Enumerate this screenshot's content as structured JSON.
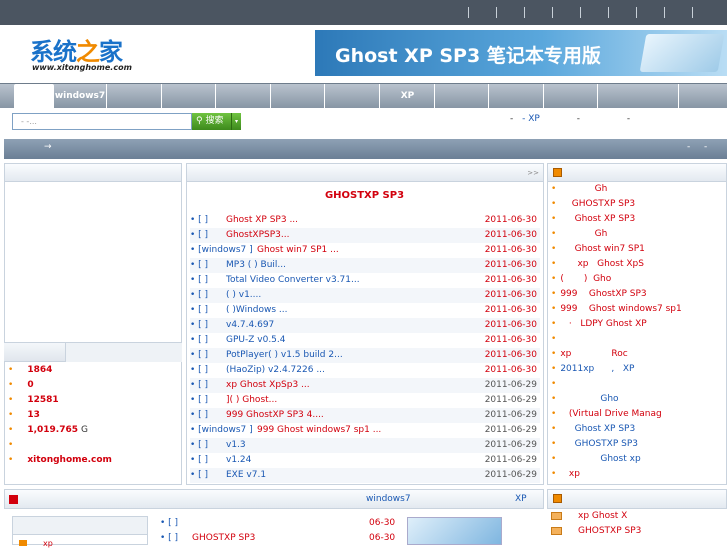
{
  "topbar": {
    "separators": 9
  },
  "logo": {
    "brand_main": "系统",
    "brand_accent": "之",
    "brand_tail": "家",
    "url": "www.xitonghome.com"
  },
  "banner": {
    "text": "Ghost XP SP3 笔记本专用版"
  },
  "nav": {
    "items": [
      "",
      "windows7",
      "",
      "",
      "",
      "",
      "",
      "XP",
      "",
      "",
      "",
      ""
    ]
  },
  "search": {
    "placeholder": "- -...",
    "button_label": "搜索",
    "dropdown": "▾"
  },
  "hotlinks": [
    "-",
    "- XP",
    "-",
    "-"
  ],
  "bluebar": {
    "arrow": "→",
    "dashes": [
      "-",
      "-"
    ]
  },
  "stats": [
    {
      "value": "1864"
    },
    {
      "value": "0"
    },
    {
      "value": "12581"
    },
    {
      "value": "13"
    },
    {
      "value": "1,019.765",
      "unit": "G"
    },
    {
      "value": ""
    },
    {
      "value": "xitonghome.com"
    }
  ],
  "center": {
    "more": ">>",
    "title": "GHOSTXP SP3",
    "rows": [
      {
        "cat": "• [  ]",
        "title": "Ghost XP SP3     ...",
        "date": "2011-06-30",
        "blue": false
      },
      {
        "cat": "• [  ]",
        "title": "          GhostXPSP3...",
        "date": "2011-06-30",
        "blue": false
      },
      {
        "cat": "• [windows7  ]",
        "title": "Ghost win7 SP1      ...",
        "date": "2011-06-30",
        "blue": false
      },
      {
        "cat": "• [  ]",
        "title": "MP3    (      ) Buil...",
        "date": "2011-06-30",
        "blue": true
      },
      {
        "cat": "• [  ]",
        "title": "  Total Video Converter v3.71...",
        "date": "2011-06-30",
        "blue": true
      },
      {
        "cat": "• [  ]",
        "title": "(       )      v1....",
        "date": "2011-06-30",
        "blue": true
      },
      {
        "cat": "• [  ]",
        "title": "(       )Windows    ...",
        "date": "2011-06-30",
        "blue": true
      },
      {
        "cat": "• [  ]",
        "title": "      v4.7.4.697",
        "date": "2011-06-30",
        "blue": true
      },
      {
        "cat": "• [  ]",
        "title": "GPU-Z v0.5.4",
        "date": "2011-06-30",
        "blue": true
      },
      {
        "cat": "• [  ]",
        "title": "PotPlayer(     ) v1.5 build 2...",
        "date": "2011-06-30",
        "blue": true
      },
      {
        "cat": "• [  ]",
        "title": "     (HaoZip) v2.4.7226    ...",
        "date": "2011-06-30",
        "blue": true
      },
      {
        "cat": "• [  ]",
        "title": "     xp   Ghost XpSp3    ...",
        "date": "2011-06-29",
        "blue": false
      },
      {
        "cat": "• [  ]",
        "title": "  ](       )  Ghost...",
        "date": "2011-06-29",
        "blue": false
      },
      {
        "cat": "• [  ]",
        "title": "999   GhostXP SP3      4....",
        "date": "2011-06-29",
        "blue": false
      },
      {
        "cat": "• [windows7  ]",
        "title": "999    Ghost windows7 sp1    ...",
        "date": "2011-06-29",
        "blue": false
      },
      {
        "cat": "• [  ]",
        "title": "     v1.3",
        "date": "2011-06-29",
        "blue": true
      },
      {
        "cat": "• [  ]",
        "title": "        v1.24",
        "date": "2011-06-29",
        "blue": true
      },
      {
        "cat": "• [  ]",
        "title": "EXE       v7.1",
        "date": "2011-06-29",
        "blue": true
      }
    ]
  },
  "right": {
    "items": [
      {
        "text": "            Gh",
        "blue": false
      },
      {
        "text": "    GHOSTXP SP3",
        "blue": false
      },
      {
        "text": "     Ghost XP SP3",
        "blue": false
      },
      {
        "text": "            Gh",
        "blue": false
      },
      {
        "text": "     Ghost win7 SP1",
        "blue": false
      },
      {
        "text": "      xp   Ghost XpS",
        "blue": false
      },
      {
        "text": "(       )  Gho",
        "blue": false
      },
      {
        "text": "999    GhostXP SP3",
        "blue": false
      },
      {
        "text": "999    Ghost windows7 sp1",
        "blue": false
      },
      {
        "text": "   ·   LDPY Ghost XP",
        "blue": false
      },
      {
        "text": "",
        "blue": false
      },
      {
        "text": "xp              Roc",
        "blue": false
      },
      {
        "text": "2011xp      ,   XP",
        "blue": true
      },
      {
        "text": "",
        "blue": false
      },
      {
        "text": "              Gho",
        "blue": true
      },
      {
        "text": "   (Virtual Drive Manag",
        "blue": false
      },
      {
        "text": "     Ghost XP SP3",
        "blue": true
      },
      {
        "text": "     GHOSTXP SP3",
        "blue": true
      },
      {
        "text": "              Ghost xp",
        "blue": true
      },
      {
        "text": "   xp",
        "blue": false
      }
    ]
  },
  "bottom": {
    "win7": "windows7",
    "xp": "XP",
    "left_label": "xp",
    "rows": [
      {
        "cat": "• [  ]",
        "title": "",
        "date": "06-30"
      },
      {
        "cat": "• [  ]",
        "title": "GHOSTXP SP3",
        "date": "06-30"
      }
    ],
    "right_items": [
      "xp   Ghost X",
      "GHOSTXP SP3"
    ]
  },
  "colors": {
    "accent_red": "#d2000d",
    "link_blue": "#1a58b3",
    "bullet_orange": "#f08a00",
    "nav_gray": "#8795a4"
  }
}
